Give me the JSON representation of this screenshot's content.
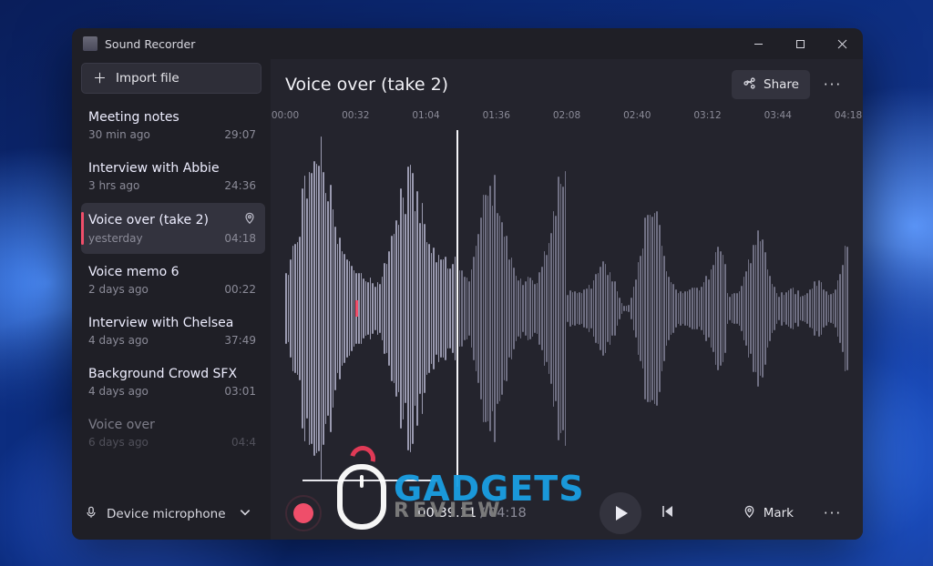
{
  "titlebar": {
    "app_name": "Sound Recorder"
  },
  "sidebar": {
    "import_label": "Import file",
    "mic_label": "Device microphone",
    "selected_index": 2,
    "recordings": [
      {
        "title": "Meeting notes",
        "subtitle": "30 min ago",
        "duration": "29:07"
      },
      {
        "title": "Interview with Abbie",
        "subtitle": "3 hrs ago",
        "duration": "24:36"
      },
      {
        "title": "Voice over (take 2)",
        "subtitle": "yesterday",
        "duration": "04:18",
        "has_location": true
      },
      {
        "title": "Voice memo 6",
        "subtitle": "2 days ago",
        "duration": "00:22"
      },
      {
        "title": "Interview with Chelsea",
        "subtitle": "4 days ago",
        "duration": "37:49"
      },
      {
        "title": "Background Crowd SFX",
        "subtitle": "4 days ago",
        "duration": "03:01"
      },
      {
        "title": "Voice over",
        "subtitle": "6 days ago",
        "duration": "04:4",
        "faded": true
      }
    ]
  },
  "main": {
    "title": "Voice over (take 2)",
    "share_label": "Share",
    "ruler_marks": [
      "00:00",
      "00:32",
      "01:04",
      "01:36",
      "02:08",
      "02:40",
      "03:12",
      "03:44",
      "04:18"
    ],
    "playhead_pct": 30.5,
    "marker_pct": 12.5,
    "selection": {
      "start_pct": 3,
      "end_pct": 27
    }
  },
  "playback": {
    "current_time": "00:39.11",
    "total_time": "04:18",
    "mark_label": "Mark"
  },
  "watermark": {
    "line1": "GADGETS",
    "line2": "REVIEW"
  },
  "colors": {
    "accent_red": "#ef4e6a",
    "bg_dark": "#1f1f26",
    "bg_panel": "#24242d"
  }
}
